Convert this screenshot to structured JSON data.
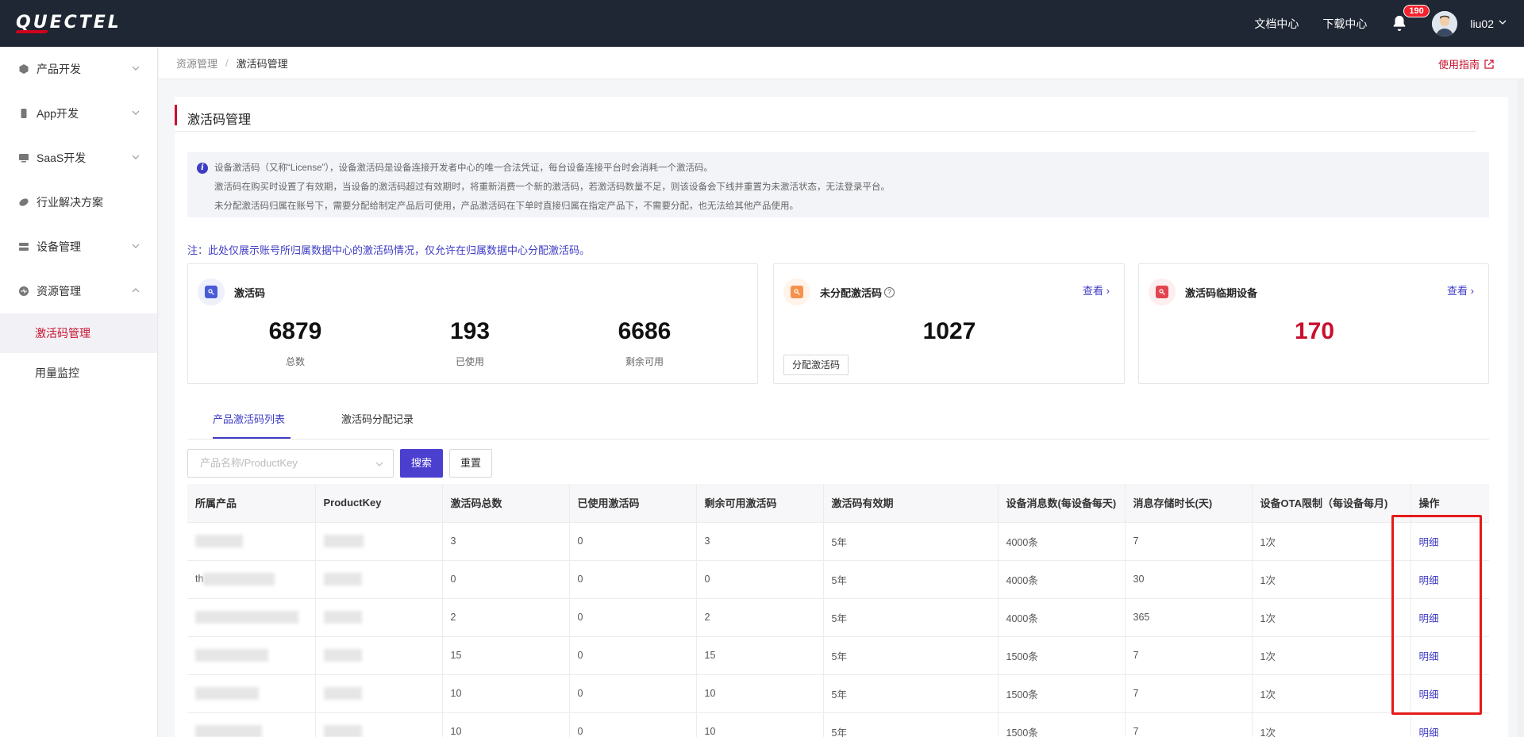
{
  "header": {
    "logo": "QUECTEL",
    "links": [
      "文档中心",
      "下载中心"
    ],
    "notification_count": "190",
    "username": "liu02"
  },
  "sidebar": {
    "items": [
      {
        "label": "产品开发",
        "icon": "cube-icon",
        "expandable": true
      },
      {
        "label": "App开发",
        "icon": "phone-icon",
        "expandable": true
      },
      {
        "label": "SaaS开发",
        "icon": "monitor-icon",
        "expandable": true
      },
      {
        "label": "行业解决方案",
        "icon": "layers-icon",
        "expandable": false
      },
      {
        "label": "设备管理",
        "icon": "server-icon",
        "expandable": true
      },
      {
        "label": "资源管理",
        "icon": "resource-icon",
        "expandable": true,
        "expanded": true
      }
    ],
    "subitems": [
      {
        "label": "激活码管理",
        "active": true
      },
      {
        "label": "用量监控",
        "active": false
      }
    ]
  },
  "breadcrumb": {
    "parent": "资源管理",
    "separator": "/",
    "current": "激活码管理",
    "guide": "使用指南"
  },
  "page": {
    "title": "激活码管理",
    "info_lines": [
      "设备激活码（又称“License”），设备激活码是设备连接开发者中心的唯一合法凭证，每台设备连接平台时会消耗一个激活码。",
      "激活码在购买时设置了有效期，当设备的激活码超过有效期时，将重新消费一个新的激活码，若激活码数量不足，则该设备会下线并重置为未激活状态，无法登录平台。",
      "未分配激活码归属在账号下，需要分配给制定产品后可使用，产品激活码在下单时直接归属在指定产品下，不需要分配，也无法给其他产品使用。"
    ],
    "note": "注：此处仅展示账号所归属数据中心的激活码情况，仅允许在归属数据中心分配激活码。"
  },
  "stats": {
    "codes": {
      "title": "激活码",
      "total": "6879",
      "total_label": "总数",
      "used": "193",
      "used_label": "已使用",
      "remaining": "6686",
      "remaining_label": "剩余可用"
    },
    "unassigned": {
      "title": "未分配激活码",
      "view": "查看",
      "value": "1027",
      "button": "分配激活码"
    },
    "expiring": {
      "title": "激活码临期设备",
      "view": "查看",
      "value": "170",
      "value_color": "#c8102e"
    }
  },
  "tabs": [
    "产品激活码列表",
    "激活码分配记录"
  ],
  "filter": {
    "placeholder": "产品名称/ProductKey",
    "search": "搜索",
    "reset": "重置"
  },
  "table": {
    "columns": [
      "所属产品",
      "ProductKey",
      "激活码总数",
      "已使用激活码",
      "剩余可用激活码",
      "激活码有效期",
      "设备消息数(每设备每天)",
      "消息存储时长(天)",
      "设备OTA限制（每设备每月)",
      "操作"
    ],
    "rows": [
      {
        "product": "",
        "key": "",
        "total": "3",
        "used": "0",
        "remaining": "3",
        "validity": "5年",
        "messages": "4000条",
        "storage": "7",
        "ota": "1次",
        "action": "明细"
      },
      {
        "product": "th",
        "key": "",
        "total": "0",
        "used": "0",
        "remaining": "0",
        "validity": "5年",
        "messages": "4000条",
        "storage": "30",
        "ota": "1次",
        "action": "明细"
      },
      {
        "product": "",
        "key": "",
        "total": "2",
        "used": "0",
        "remaining": "2",
        "validity": "5年",
        "messages": "4000条",
        "storage": "365",
        "ota": "1次",
        "action": "明细"
      },
      {
        "product": "",
        "key": "",
        "total": "15",
        "used": "0",
        "remaining": "15",
        "validity": "5年",
        "messages": "1500条",
        "storage": "7",
        "ota": "1次",
        "action": "明细"
      },
      {
        "product": "",
        "key": "",
        "total": "10",
        "used": "0",
        "remaining": "10",
        "validity": "5年",
        "messages": "1500条",
        "storage": "7",
        "ota": "1次",
        "action": "明细"
      },
      {
        "product": "",
        "key": "",
        "total": "10",
        "used": "0",
        "remaining": "10",
        "validity": "5年",
        "messages": "1500条",
        "storage": "7",
        "ota": "1次",
        "action": "明细"
      }
    ]
  },
  "colors": {
    "brand_red": "#c8102e",
    "accent_purple": "#3f3cc4",
    "topbar": "#1e2733"
  }
}
